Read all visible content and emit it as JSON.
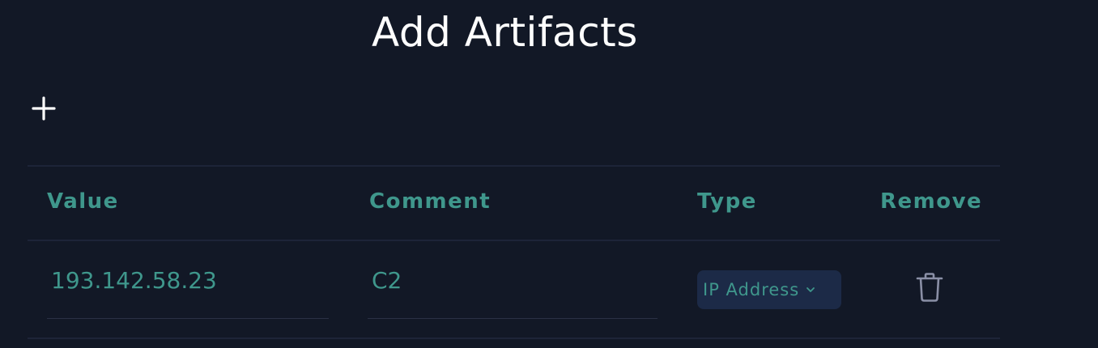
{
  "header": {
    "title": "Add Artifacts"
  },
  "toolbar": {
    "add_icon": "plus-icon"
  },
  "table": {
    "columns": [
      "Value",
      "Comment",
      "Type",
      "Remove"
    ],
    "rows": [
      {
        "value": "193.142.58.23",
        "comment": "C2",
        "type": "IP Address",
        "remove_icon": "trash-icon"
      }
    ]
  },
  "colors": {
    "background": "#121826",
    "accent": "#3f978c",
    "select_bg": "#1c2a47",
    "icon_gray": "#8a8fa6"
  }
}
